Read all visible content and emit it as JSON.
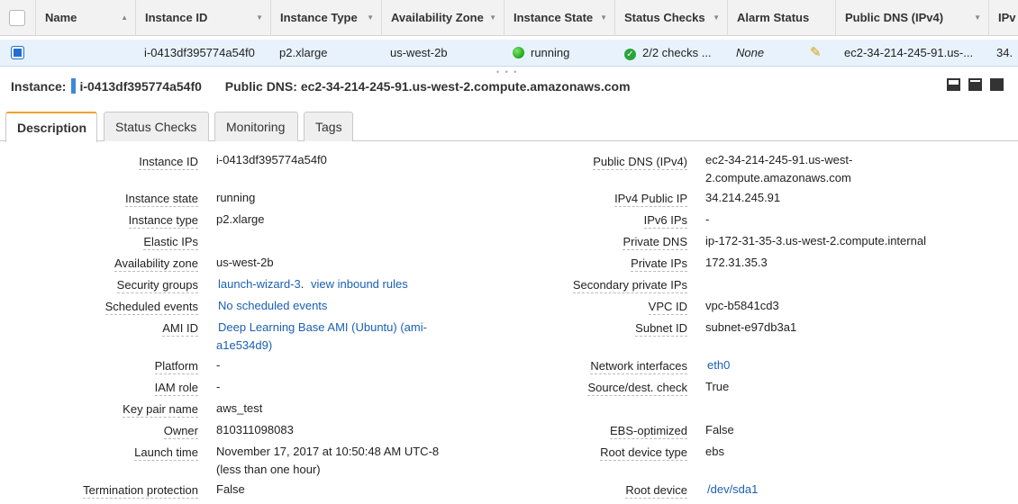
{
  "table": {
    "headers": [
      "Name",
      "Instance ID",
      "Instance Type",
      "Availability Zone",
      "Instance State",
      "Status Checks",
      "Alarm Status",
      "Public DNS (IPv4)",
      "IPv"
    ],
    "row": {
      "name": "",
      "instance_id": "i-0413df395774a54f0",
      "instance_type": "p2.xlarge",
      "availability_zone": "us-west-2b",
      "instance_state": "running",
      "status_checks": "2/2 checks ...",
      "alarm_status": "None",
      "public_dns": "ec2-34-214-245-91.us-...",
      "ipv4": "34."
    }
  },
  "instance_header": {
    "instance_label": "Instance:",
    "instance_id": "i-0413df395774a54f0",
    "dns_label": "Public DNS:",
    "dns_value": "ec2-34-214-245-91.us-west-2.compute.amazonaws.com"
  },
  "tabs": [
    "Description",
    "Status Checks",
    "Monitoring",
    "Tags"
  ],
  "description": {
    "left": {
      "instance_id": {
        "label": "Instance ID",
        "value": "i-0413df395774a54f0"
      },
      "instance_state": {
        "label": "Instance state",
        "value": "running"
      },
      "instance_type": {
        "label": "Instance type",
        "value": "p2.xlarge"
      },
      "elastic_ips": {
        "label": "Elastic IPs",
        "value": ""
      },
      "availability_zone": {
        "label": "Availability zone",
        "value": "us-west-2b"
      },
      "security_groups": {
        "label": "Security groups",
        "link1": "launch-wizard-3",
        "sep": ".",
        "link2": "view inbound rules"
      },
      "scheduled_events": {
        "label": "Scheduled events",
        "value": "No scheduled events"
      },
      "ami_id": {
        "label": "AMI ID",
        "line1": "Deep Learning Base AMI (Ubuntu) (ami-",
        "line2": "a1e534d9)"
      },
      "platform": {
        "label": "Platform",
        "value": "-"
      },
      "iam_role": {
        "label": "IAM role",
        "value": "-"
      },
      "key_pair": {
        "label": "Key pair name",
        "value": "aws_test"
      },
      "owner": {
        "label": "Owner",
        "value": "810311098083"
      },
      "launch_time": {
        "label": "Launch time",
        "line1": "November 17, 2017 at 10:50:48 AM UTC-8",
        "line2": "(less than one hour)"
      },
      "termination": {
        "label": "Termination protection",
        "value": "False"
      }
    },
    "right": {
      "public_dns": {
        "label": "Public DNS (IPv4)",
        "line1": "ec2-34-214-245-91.us-west-",
        "line2": "2.compute.amazonaws.com"
      },
      "ipv4_public_ip": {
        "label": "IPv4 Public IP",
        "value": "34.214.245.91"
      },
      "ipv6_ips": {
        "label": "IPv6 IPs",
        "value": "-"
      },
      "private_dns": {
        "label": "Private DNS",
        "value": "ip-172-31-35-3.us-west-2.compute.internal"
      },
      "private_ips": {
        "label": "Private IPs",
        "value": "172.31.35.3"
      },
      "secondary_private_ips": {
        "label": "Secondary private IPs",
        "value": ""
      },
      "vpc_id": {
        "label": "VPC ID",
        "value": "vpc-b5841cd3"
      },
      "subnet_id": {
        "label": "Subnet ID",
        "value": "subnet-e97db3a1"
      },
      "network_interfaces": {
        "label": "Network interfaces",
        "value": "eth0"
      },
      "source_dest": {
        "label": "Source/dest. check",
        "value": "True"
      },
      "ebs_optimized": {
        "label": "EBS-optimized",
        "value": "False"
      },
      "root_device_type": {
        "label": "Root device type",
        "value": "ebs"
      },
      "root_device": {
        "label": "Root device",
        "value": "/dev/sda1"
      }
    }
  },
  "colors": {
    "accent": "#1f6fd1",
    "link": "#1b5fb4",
    "running": "#1ea81a",
    "tab_active": "#f0a030"
  }
}
